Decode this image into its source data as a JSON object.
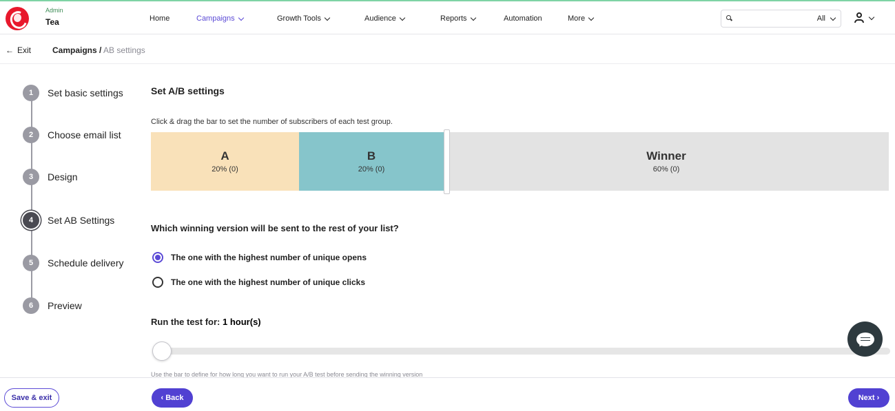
{
  "header": {
    "account_role": "Admin",
    "account_name": "Tea",
    "nav": [
      {
        "label": "Home",
        "has_menu": false
      },
      {
        "label": "Campaigns",
        "has_menu": true,
        "active": true
      },
      {
        "label": "Growth Tools",
        "has_menu": true
      },
      {
        "label": "Audience",
        "has_menu": true
      },
      {
        "label": "Reports",
        "has_menu": true
      },
      {
        "label": "Automation",
        "has_menu": false
      },
      {
        "label": "More",
        "has_menu": true
      }
    ],
    "search_value": "",
    "search_scope": "All"
  },
  "breadcrumb": {
    "exit_label": "Exit",
    "parent": "Campaigns",
    "separator": "/",
    "current": "AB settings"
  },
  "steps": [
    {
      "number": "1",
      "label": "Set basic settings"
    },
    {
      "number": "2",
      "label": "Choose email list"
    },
    {
      "number": "3",
      "label": "Design"
    },
    {
      "number": "4",
      "label": "Set AB Settings",
      "current": true
    },
    {
      "number": "5",
      "label": "Schedule delivery"
    },
    {
      "number": "6",
      "label": "Preview"
    }
  ],
  "ab_settings": {
    "title": "Set A/B settings",
    "instruction": "Click & drag the bar to set the number of subscribers of each test group.",
    "groups": [
      {
        "name": "A",
        "share": "20% (0)",
        "percent": 20,
        "color": "#f9e1b9"
      },
      {
        "name": "B",
        "share": "20% (0)",
        "percent": 20,
        "color": "#86c5cb"
      },
      {
        "name": "Winner",
        "share": "60% (0)",
        "percent": 60,
        "color": "#e3e3e3"
      }
    ],
    "winner_question": "Which winning version will be sent to the rest of your list?",
    "winner_options": [
      {
        "label": "The one with the highest number of unique opens",
        "selected": true
      },
      {
        "label": "The one with the highest number of unique clicks",
        "selected": false
      }
    ],
    "run_test_label": "Run the test for:",
    "run_test_value": "1 hour(s)",
    "duration_help": "Use the bar to define for how long you want to run your A/B test before sending the winning version"
  },
  "footer": {
    "save_label": "Save & exit",
    "back_label": "‹ Back",
    "next_label": "Next ›"
  },
  "colors": {
    "accent": "#5141d2",
    "brand": "#e8182c",
    "chat": "#2e3a3f"
  }
}
